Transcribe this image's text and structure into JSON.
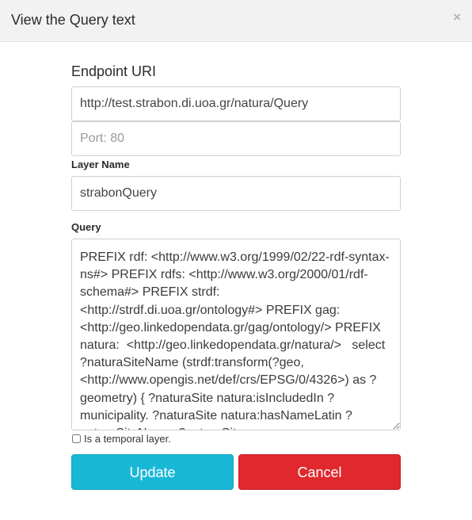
{
  "dialog": {
    "title": "View the Query text",
    "close_symbol": "×"
  },
  "endpoint": {
    "heading": "Endpoint URI",
    "uri_value": "http://test.strabon.di.uoa.gr/natura/Query",
    "port_placeholder": "Port: 80",
    "port_value": ""
  },
  "layer": {
    "label": "Layer Name",
    "value": "strabonQuery"
  },
  "query": {
    "label": "Query",
    "value": "PREFIX rdf: <http://www.w3.org/1999/02/22-rdf-syntax-ns#> PREFIX rdfs: <http://www.w3.org/2000/01/rdf-schema#> PREFIX strdf: <http://strdf.di.uoa.gr/ontology#> PREFIX gag: <http://geo.linkedopendata.gr/gag/ontology/> PREFIX natura:  <http://geo.linkedopendata.gr/natura/>   select ?naturaSiteName (strdf:transform(?geo, <http://www.opengis.net/def/crs/EPSG/0/4326>) as ?geometry) { ?naturaSite natura:isIncludedIn ?municipality. ?naturaSite natura:hasNameLatin ?naturaSiteName. ?naturaSite"
  },
  "temporal": {
    "label": "Is a temporal layer.",
    "checked": false
  },
  "buttons": {
    "update": "Update",
    "cancel": "Cancel"
  },
  "colors": {
    "update": "#19b7d6",
    "cancel": "#e0282e",
    "header_bg": "#f2f2f2"
  }
}
